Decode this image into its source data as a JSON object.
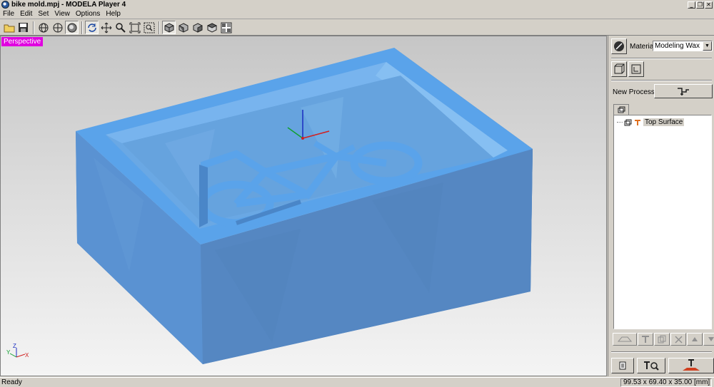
{
  "window": {
    "title": "bike mold.mpj - MODELA Player 4",
    "controls": [
      "_",
      "❐",
      "✕"
    ]
  },
  "menu": [
    "File",
    "Edit",
    "Set",
    "View",
    "Options",
    "Help"
  ],
  "toolbar": {
    "icons": [
      "open-icon",
      "save-icon",
      "view-wire-icon",
      "view-solid-icon",
      "view-shaded-icon",
      "rotate-icon",
      "pan-icon",
      "zoom-icon",
      "fit-icon",
      "zoom-window-icon",
      "iso-view-icon",
      "front-view-icon",
      "side-view-icon",
      "back-view-icon",
      "grid-view-icon"
    ]
  },
  "viewport": {
    "view_label": "Perspective",
    "model_color": "#5aa3ea",
    "axis_labels": {
      "x": "X",
      "y": "Y",
      "z": "Z"
    }
  },
  "panel": {
    "material_label": "Material",
    "material_value": "Modeling Wax",
    "new_process_label": "New Process",
    "tree": [
      {
        "label": "Top Surface"
      }
    ]
  },
  "status": {
    "text": "Ready",
    "dimensions": "99.53 x 69.40 x 35.00 [mm]"
  }
}
